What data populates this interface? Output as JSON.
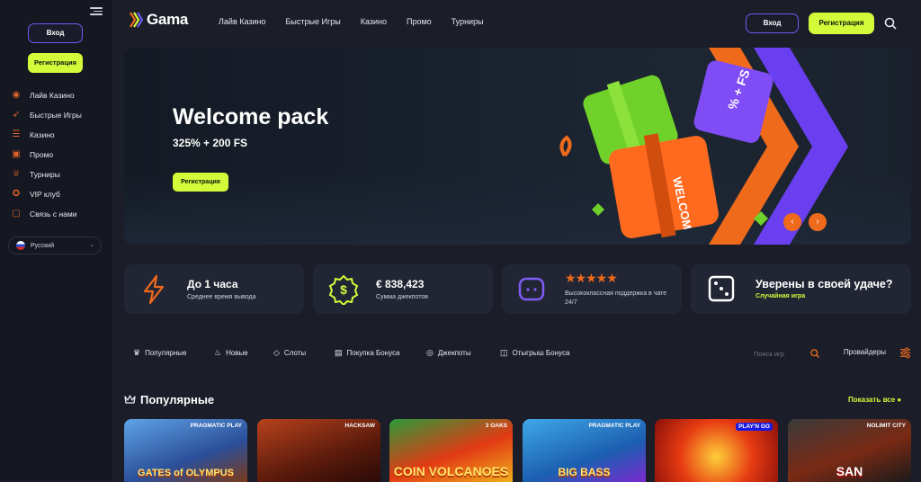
{
  "sidebar": {
    "login_label": "Вход",
    "register_label": "Регистрация",
    "items": [
      {
        "label": "Лайв Казино",
        "icon": "live-icon"
      },
      {
        "label": "Быстрые Игры",
        "icon": "rocket-icon"
      },
      {
        "label": "Казино",
        "icon": "coins-icon"
      },
      {
        "label": "Промо",
        "icon": "gift-icon"
      },
      {
        "label": "Турниры",
        "icon": "trophy-icon"
      },
      {
        "label": "VIP клуб",
        "icon": "medal-icon"
      },
      {
        "label": "Связь с нами",
        "icon": "chat-icon"
      }
    ],
    "language": "Русский"
  },
  "header": {
    "logo": "Gama",
    "nav": [
      "Лайв Казино",
      "Быстрые Игры",
      "Казино",
      "Промо",
      "Турниры"
    ],
    "login_label": "Вход",
    "register_label": "Регистрация"
  },
  "banner": {
    "title": "Welcome pack",
    "subtitle": "325% + 200 FS",
    "button": "Регистрация",
    "gift_text": "WELCOM",
    "gift_text_2": "% + FS"
  },
  "stats": [
    {
      "title": "До 1 часа",
      "subtitle": "Среднее время вывода",
      "icon": "lightning-icon"
    },
    {
      "title": "€ 838,423",
      "subtitle": "Сумма джекпотов",
      "icon": "dollar-badge-icon"
    },
    {
      "title": "",
      "subtitle": "Высококлассная поддержка в чате 24/7",
      "icon": "chat-bubble-icon",
      "rating": 4.5
    },
    {
      "title": "Уверены в своей удаче?",
      "subtitle": "Случайная игра",
      "icon": "dice-icon"
    }
  ],
  "filters": [
    "Популярные",
    "Новые",
    "Слоты",
    "Покупка Бонуса",
    "Джекпоты",
    "Отыгрыш Бонуса"
  ],
  "search": {
    "placeholder": "Поиск игр"
  },
  "providers_label": "Провайдеры",
  "section": {
    "title": "Популярные",
    "show_all": "Показать все"
  },
  "games": [
    {
      "title": "GATES of OLYMPUS",
      "provider": "PRAGMATIC PLAY"
    },
    {
      "title": "",
      "provider": "HACKSAW"
    },
    {
      "title": "COIN VOLCANOES",
      "provider": "3 OAKS"
    },
    {
      "title": "BIG BASS",
      "provider": "PRAGMATIC PLAY"
    },
    {
      "title": "",
      "provider": "PLAY'N GO"
    },
    {
      "title": "SAN",
      "provider": "NOLIMIT CITY"
    }
  ],
  "colors": {
    "accent": "#d4fb39",
    "orange": "#f06a1c",
    "purple": "#6a5cf4"
  }
}
